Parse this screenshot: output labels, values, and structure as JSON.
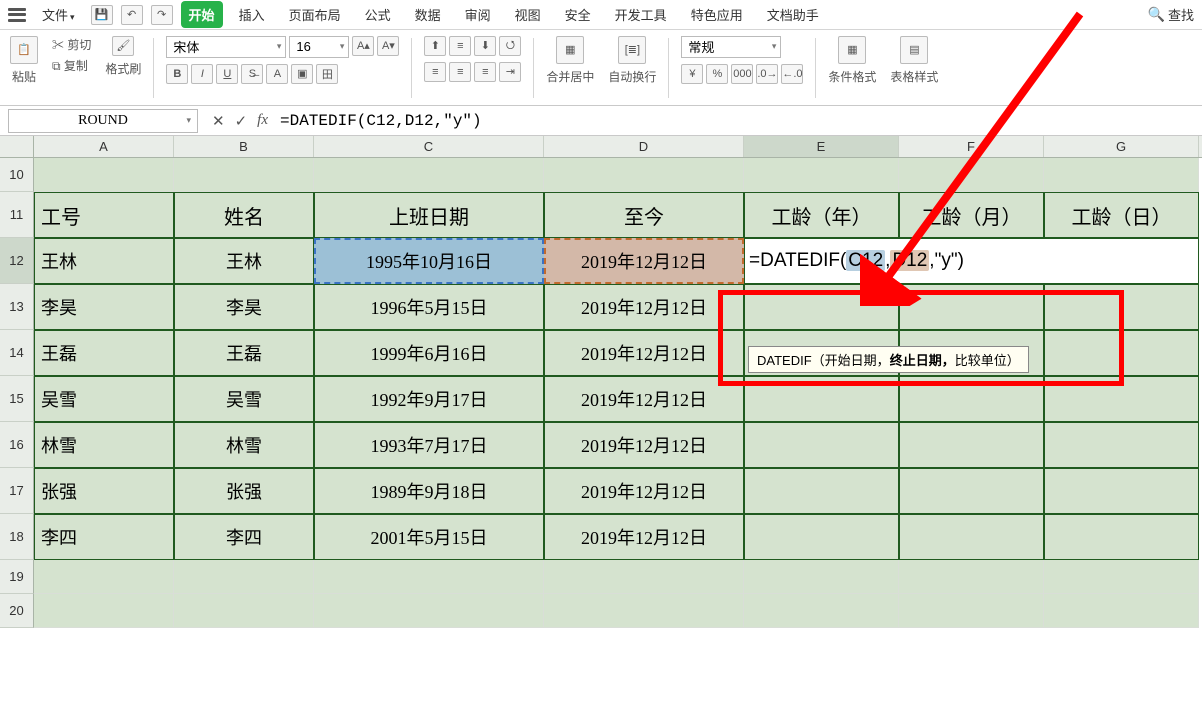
{
  "menu": {
    "file": "文件",
    "tabs": [
      "开始",
      "插入",
      "页面布局",
      "公式",
      "数据",
      "审阅",
      "视图",
      "安全",
      "开发工具",
      "特色应用",
      "文档助手"
    ],
    "active_index": 0,
    "search": "查找"
  },
  "ribbon": {
    "paste": "粘贴",
    "cut": "剪切",
    "copy": "复制",
    "format_painter": "格式刷",
    "font_name": "宋体",
    "font_size": "16",
    "merge_center": "合并居中",
    "auto_wrap": "自动换行",
    "general_fmt": "常规",
    "percent": "%",
    "cond_format": "条件格式",
    "table_format": "表格样式"
  },
  "formula_bar": {
    "name_box": "ROUND",
    "formula": "=DATEDIF(C12,D12,\"y\")"
  },
  "columns": [
    "A",
    "B",
    "C",
    "D",
    "E",
    "F",
    "G"
  ],
  "row_header_start": 10,
  "headers": {
    "A": "工号",
    "B": "姓名",
    "C": "上班日期",
    "D": "至今",
    "E": "工龄（年）",
    "F": "工龄（月）",
    "G": "工龄（日）"
  },
  "rows": [
    {
      "n": 12,
      "A": "王林",
      "B": "王林",
      "C": "1995年10月16日",
      "D": "2019年12月12日"
    },
    {
      "n": 13,
      "A": "李昊",
      "B": "李昊",
      "C": "1996年5月15日",
      "D": "2019年12月12日"
    },
    {
      "n": 14,
      "A": "王磊",
      "B": "王磊",
      "C": "1999年6月16日",
      "D": "2019年12月12日"
    },
    {
      "n": 15,
      "A": "吴雪",
      "B": "吴雪",
      "C": "1992年9月17日",
      "D": "2019年12月12日"
    },
    {
      "n": 16,
      "A": "林雪",
      "B": "林雪",
      "C": "1993年7月17日",
      "D": "2019年12月12日"
    },
    {
      "n": 17,
      "A": "张强",
      "B": "张强",
      "C": "1989年9月18日",
      "D": "2019年12月12日"
    },
    {
      "n": 18,
      "A": "李四",
      "B": "李四",
      "C": "2001年5月15日",
      "D": "2019年12月12日"
    }
  ],
  "active_cell": {
    "prefix": "=DATEDIF(",
    "arg1": "C12",
    "comma1": ",",
    "arg2": "D12",
    "comma2": ",",
    "suffix": "\"y\")"
  },
  "tooltip": {
    "fn": "DATEDIF",
    "open": "（",
    "p1": "开始日期，",
    "p2": "终止日期，",
    "p3": "比较单位",
    "close": "）"
  }
}
